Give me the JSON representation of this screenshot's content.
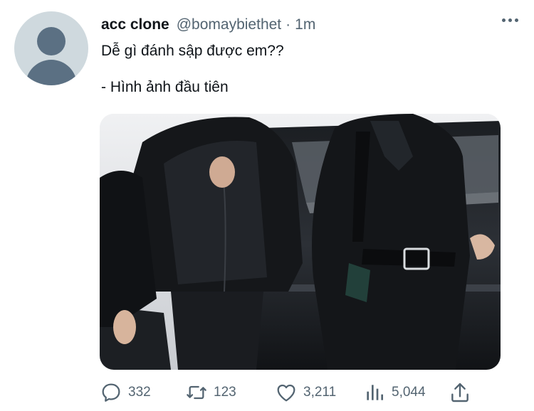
{
  "tweet": {
    "display_name": "acc clone",
    "handle": "@bomaybiethet",
    "separator": "·",
    "time": "1m",
    "text_line1": "Dễ gì đánh sập được em??",
    "text_line2": "- Hình ảnh đầu tiên"
  },
  "actions": {
    "replies": "332",
    "retweets": "123",
    "likes": "3,211",
    "views": "5,044"
  },
  "icons": {
    "avatar": "default-avatar-icon",
    "more": "more-horizontal-icon",
    "reply": "reply-icon",
    "retweet": "retweet-icon",
    "like": "heart-icon",
    "views": "views-bar-chart-icon",
    "share": "share-icon"
  },
  "colors": {
    "text": "#0f1419",
    "secondary": "#536471",
    "avatar_bg": "#cfd9de",
    "avatar_fg": "#5b7083"
  }
}
